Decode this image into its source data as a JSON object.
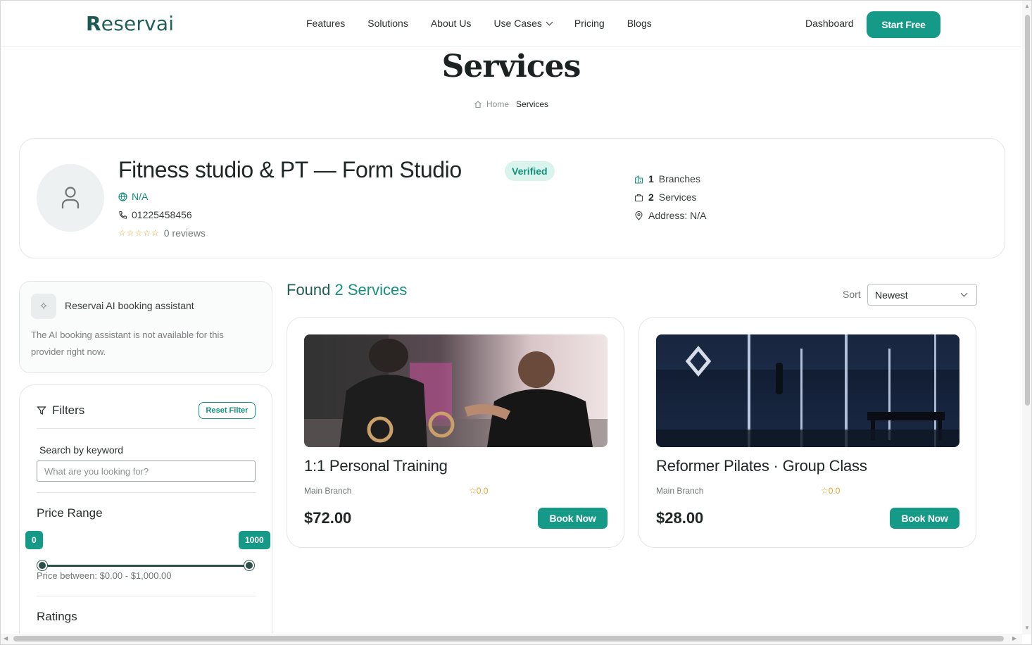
{
  "nav": {
    "logo_initial": "R",
    "logo_rest": "eservai",
    "items": [
      "Features",
      "Solutions",
      "About Us",
      "Use Cases",
      "Pricing",
      "Blogs"
    ],
    "dashboard": "Dashboard",
    "start": "Start Free"
  },
  "page": {
    "title": "Services",
    "breadcrumb_home": "Home",
    "breadcrumb_current": "Services"
  },
  "provider": {
    "name": "Fitness studio & PT — Form Studio",
    "verified": "Verified",
    "website": "N/A",
    "phone": "01225458456",
    "stars": "☆☆☆☆☆",
    "reviews": "0 reviews",
    "branches_count": "1",
    "branches_label": "Branches",
    "services_count": "2",
    "services_label": "Services",
    "address": "Address: N/A"
  },
  "assistant": {
    "title": "Reservai AI booking assistant",
    "message": "The AI booking assistant is not available for this provider right now."
  },
  "filters": {
    "title": "Filters",
    "reset": "Reset Filter",
    "keyword_label": "Search by keyword",
    "keyword_placeholder": "What are you looking for?",
    "price_title": "Price Range",
    "price_min": "0",
    "price_max": "1000",
    "price_text": "Price between: $0.00 - $1,000.00",
    "ratings_title": "Ratings"
  },
  "results": {
    "found_label": "Found",
    "found_count": "2 Services",
    "sort_label": "Sort",
    "sort_value": "Newest",
    "services": [
      {
        "title": "1:1 Personal Training",
        "branch": "Main Branch",
        "rating": "☆0.0",
        "price": "$72.00",
        "button": "Book Now"
      },
      {
        "title": "Reformer Pilates · Group Class",
        "branch": "Main Branch",
        "rating": "☆0.0",
        "price": "$28.00",
        "button": "Book Now"
      }
    ]
  },
  "colors": {
    "accent": "#149a86",
    "brand": "#1b5a53",
    "star": "#e6a52a"
  }
}
